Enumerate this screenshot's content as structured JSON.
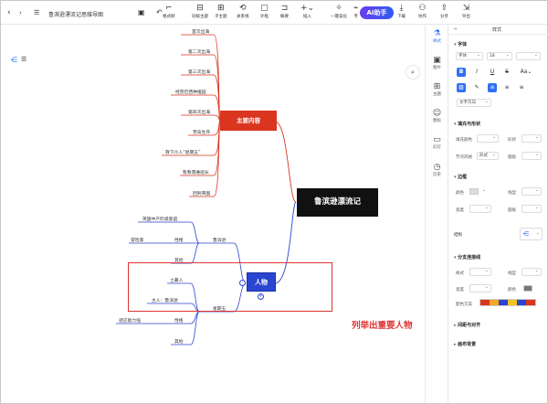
{
  "document": {
    "title": "鲁滨逊漂流记思维导图"
  },
  "toolbar": {
    "items": [
      {
        "label": "格式刷"
      },
      {
        "label": "同级主题"
      },
      {
        "label": "子主题"
      },
      {
        "label": "关系线"
      },
      {
        "label": "外框"
      },
      {
        "label": "概要"
      },
      {
        "label": "插入"
      },
      {
        "label": "一键美化"
      },
      {
        "label": "专"
      },
      {
        "label": "下载"
      },
      {
        "label": "协作"
      },
      {
        "label": "分享"
      },
      {
        "label": "导出"
      }
    ],
    "ai_label": "AI助手"
  },
  "sidebar_tabs": [
    {
      "label": "样式"
    },
    {
      "label": "图片"
    },
    {
      "label": "主题"
    },
    {
      "label": "图标"
    },
    {
      "label": "幻灯"
    },
    {
      "label": "历史"
    }
  ],
  "panel": {
    "title": "样式",
    "font_section": "字体",
    "font_family": "字体",
    "font_size": "18",
    "text_direction": "文字方向",
    "fill_section": "填充与形状",
    "fill_color_label": "填充颜色",
    "shape_label": "形状",
    "node_style_label": "节点风格",
    "node_style_value": "形式",
    "round_label": "圆角",
    "border_section": "边框",
    "border_color_label": "颜色",
    "line_type_label": "线型",
    "thickness_label": "宽度",
    "corner_label": "圆角",
    "structure_label": "结构",
    "branch_section": "分支连接线",
    "branch_style_label": "样式",
    "branch_line_label": "线型",
    "branch_width_label": "宽度",
    "branch_color_label": "颜色",
    "color_scheme_label": "配色方案",
    "spacing_section": "间距与对齐",
    "background_section": "画布背景",
    "scheme_colors": [
      "#d9351f",
      "#f5a623",
      "#2a45d0",
      "#f5c518",
      "#2a45d0",
      "#d9351f"
    ]
  },
  "mindmap": {
    "root": "鲁滨逊漂流记",
    "main_topic": "主要内容",
    "main_items": [
      "首次出海",
      "第二次出海",
      "第三次出海",
      "经营巴西种植园",
      "第四次出海",
      "荒岛生存",
      "救下仆人“星期五”",
      "暂救落难船长",
      "回到英国"
    ],
    "characters_topic": "人物",
    "characters": {
      "robinson": {
        "name": "鲁滨逊",
        "details": [
          "英国中产阶级家庭",
          "冒险家"
        ],
        "trait_label": "性格",
        "other_label": "其他"
      },
      "friday": {
        "name": "星期五",
        "details": [
          "土著人",
          "主人：鲁滨逊"
        ],
        "trait_label": "性格",
        "trait_value": "适应能力强",
        "other_label": "其他"
      }
    }
  },
  "annotation": "列举出重要人物",
  "colors": {
    "root_bg": "#111111",
    "main_topic_bg": "#d9351f",
    "characters_bg": "#2a45d0",
    "red_branch": "#d9351f",
    "blue_branch": "#2a45d0",
    "highlight": "#dd3333",
    "accent": "#2f6ff5"
  }
}
